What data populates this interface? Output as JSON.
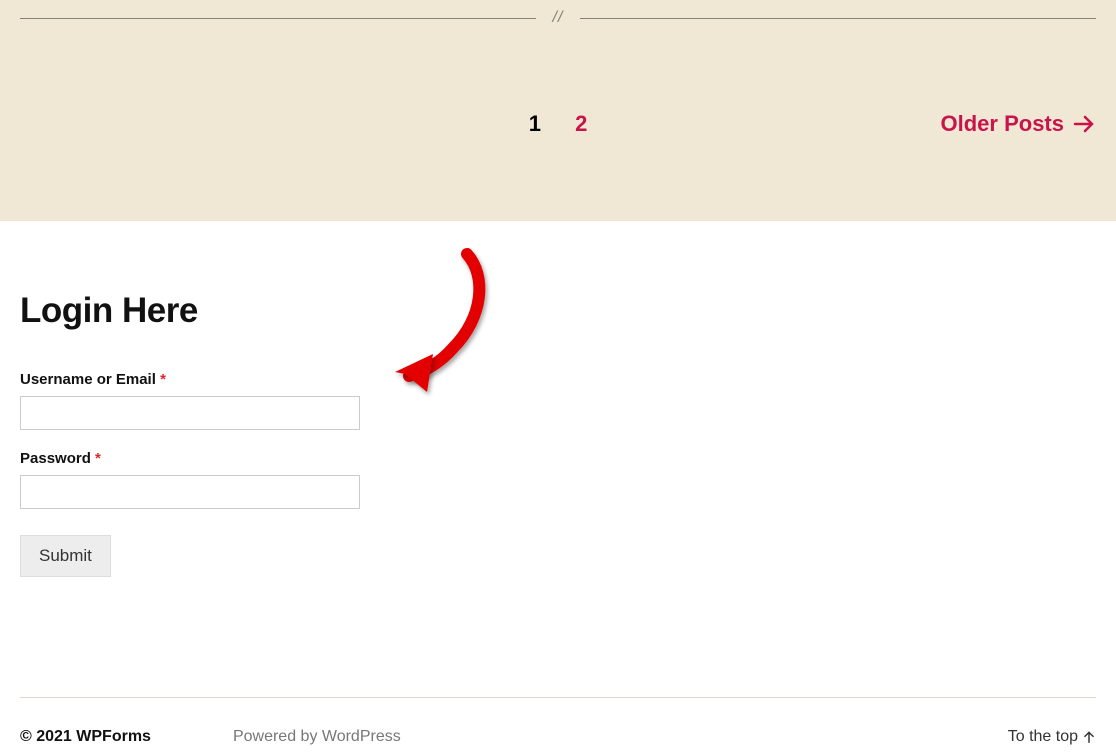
{
  "pagination": {
    "current_page": "1",
    "next_page": "2",
    "older_posts_label": "Older Posts"
  },
  "login": {
    "title": "Login Here",
    "username_label": "Username or Email",
    "username_value": "",
    "password_label": "Password",
    "password_value": "",
    "required_mark": "*",
    "submit_label": "Submit"
  },
  "footer": {
    "copyright": "© 2021 WPForms",
    "powered_by": "Powered by WordPress",
    "to_top": "To the top"
  }
}
